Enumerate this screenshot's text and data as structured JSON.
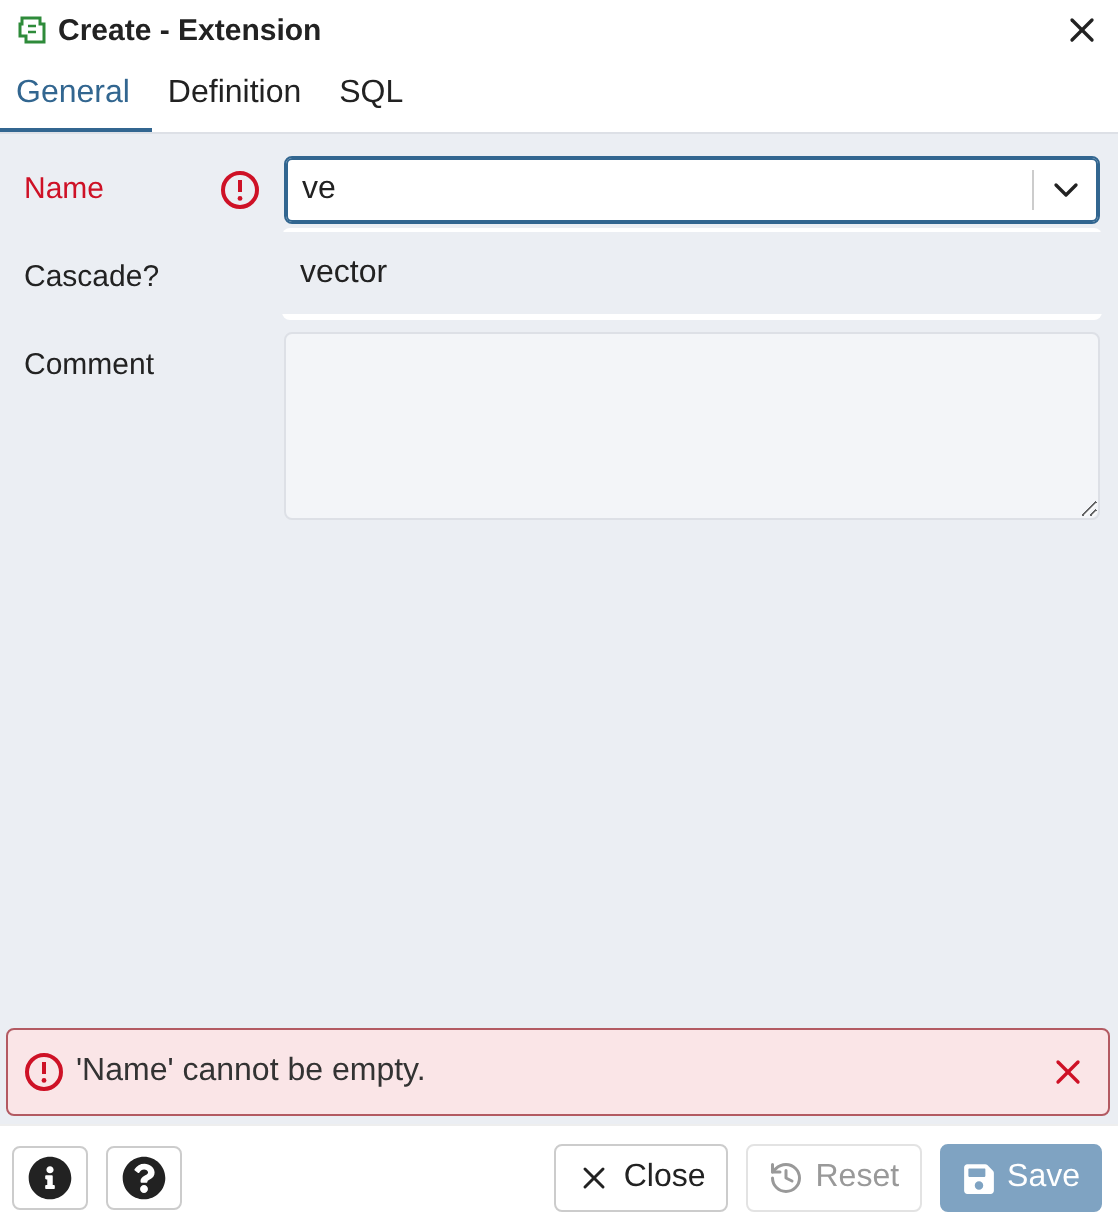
{
  "window": {
    "title": "Create - Extension"
  },
  "tabs": [
    {
      "label": "General",
      "selected": true
    },
    {
      "label": "Definition",
      "selected": false
    },
    {
      "label": "SQL",
      "selected": false
    }
  ],
  "fields": [
    {
      "kind": "select",
      "label": "Name",
      "value": "ve",
      "invalid": true,
      "focused": true,
      "options": [
        "vector"
      ]
    },
    {
      "kind": "checkbox",
      "label": "Cascade?"
    },
    {
      "kind": "textarea",
      "label": "Comment"
    }
  ],
  "error": {
    "message": "'Name' cannot be empty."
  },
  "buttons": [
    {
      "kind": "close",
      "label": "Close",
      "disabled": false
    },
    {
      "kind": "reset",
      "label": "Reset",
      "disabled": true
    },
    {
      "kind": "save",
      "label": "Save",
      "disabled": true
    }
  ]
}
